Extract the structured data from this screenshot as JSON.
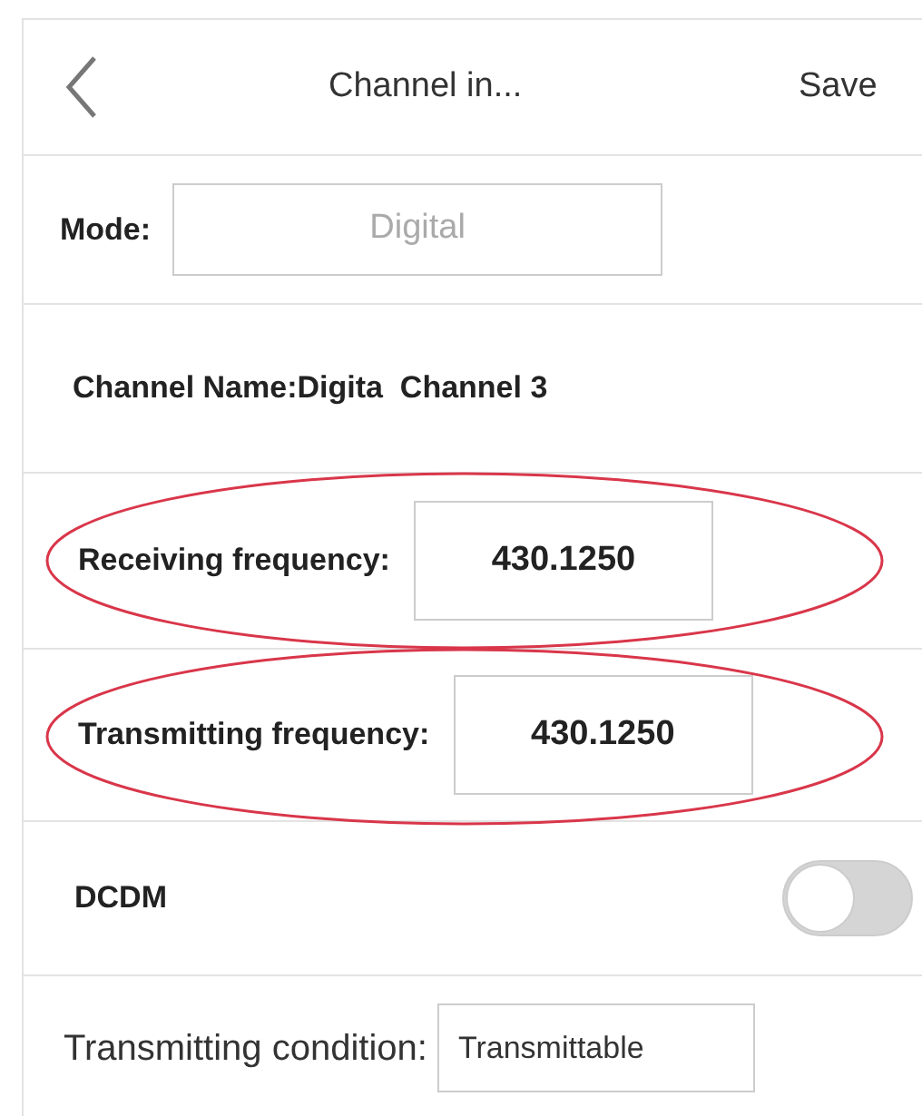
{
  "header": {
    "title": "Channel in...",
    "action": "Save"
  },
  "rows": [
    {
      "kind": "field",
      "label": "Mode:",
      "value": "Digital",
      "disabled": true,
      "highlighted": false
    },
    {
      "kind": "text",
      "label": "Channel Name:Digita  Channel 3",
      "highlighted": false
    },
    {
      "kind": "field",
      "label": "Receiving frequency:",
      "value": "430.1250",
      "disabled": false,
      "highlighted": true
    },
    {
      "kind": "field",
      "label": "Transmitting frequency:",
      "value": "430.1250",
      "disabled": false,
      "highlighted": true
    },
    {
      "kind": "toggle",
      "label": "DCDM",
      "on": false,
      "highlighted": false
    },
    {
      "kind": "select",
      "label": "Transmitting condition:",
      "value": "Transmittable",
      "highlighted": false
    }
  ]
}
